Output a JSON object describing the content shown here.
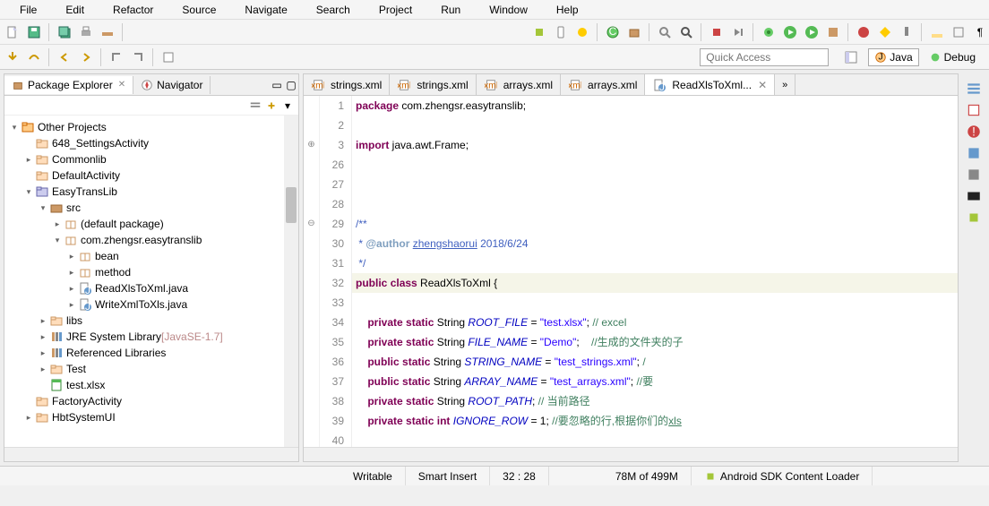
{
  "menus": [
    "File",
    "Edit",
    "Refactor",
    "Source",
    "Navigate",
    "Search",
    "Project",
    "Run",
    "Window",
    "Help"
  ],
  "quick_access_placeholder": "Quick Access",
  "perspectives": {
    "java": "Java",
    "debug": "Debug"
  },
  "left": {
    "tabs": {
      "pkg": "Package Explorer",
      "nav": "Navigator"
    },
    "tree": [
      {
        "d": 0,
        "tw": "▾",
        "ic": "proj",
        "t": "Other Projects"
      },
      {
        "d": 1,
        "tw": "",
        "ic": "fldr",
        "t": "648_SettingsActivity"
      },
      {
        "d": 1,
        "tw": "▸",
        "ic": "fldr",
        "t": "Commonlib"
      },
      {
        "d": 1,
        "tw": "",
        "ic": "fldr",
        "t": "DefaultActivity"
      },
      {
        "d": 1,
        "tw": "▾",
        "ic": "prj",
        "t": "EasyTransLib"
      },
      {
        "d": 2,
        "tw": "▾",
        "ic": "src",
        "t": "src"
      },
      {
        "d": 3,
        "tw": "▸",
        "ic": "pkg",
        "t": "(default package)"
      },
      {
        "d": 3,
        "tw": "▾",
        "ic": "pkg",
        "t": "com.zhengsr.easytranslib"
      },
      {
        "d": 4,
        "tw": "▸",
        "ic": "pkg",
        "t": "bean"
      },
      {
        "d": 4,
        "tw": "▸",
        "ic": "pkg",
        "t": "method"
      },
      {
        "d": 4,
        "tw": "▸",
        "ic": "java",
        "t": "ReadXlsToXml.java"
      },
      {
        "d": 4,
        "tw": "▸",
        "ic": "java",
        "t": "WriteXmlToXls.java"
      },
      {
        "d": 2,
        "tw": "▸",
        "ic": "fldr",
        "t": "libs"
      },
      {
        "d": 2,
        "tw": "▸",
        "ic": "lib",
        "t": "JRE System Library",
        "suf": " [JavaSE-1.7]"
      },
      {
        "d": 2,
        "tw": "▸",
        "ic": "lib",
        "t": "Referenced Libraries"
      },
      {
        "d": 2,
        "tw": "▸",
        "ic": "fldr",
        "t": "Test"
      },
      {
        "d": 2,
        "tw": "",
        "ic": "xls",
        "t": "test.xlsx"
      },
      {
        "d": 1,
        "tw": "",
        "ic": "fldr",
        "t": "FactoryActivity"
      },
      {
        "d": 1,
        "tw": "▸",
        "ic": "fldr",
        "t": "HbtSystemUI"
      }
    ]
  },
  "editor": {
    "tabs": [
      {
        "label": "strings.xml",
        "ic": "xml"
      },
      {
        "label": "strings.xml",
        "ic": "xml"
      },
      {
        "label": "arrays.xml",
        "ic": "xml"
      },
      {
        "label": "arrays.xml",
        "ic": "xml"
      },
      {
        "label": "ReadXlsToXml...",
        "ic": "java",
        "active": true
      }
    ],
    "lines": [
      {
        "n": 1,
        "h": "<span class='kw'>package</span> com.zhengsr.easytranslib;"
      },
      {
        "n": 2,
        "h": ""
      },
      {
        "n": 3,
        "h": "<span class='kw'>import</span> java.awt.Frame;",
        "mark": "⊕"
      },
      {
        "n": 26,
        "h": ""
      },
      {
        "n": 27,
        "h": ""
      },
      {
        "n": 28,
        "h": ""
      },
      {
        "n": 29,
        "h": "<span class='doc'>/**</span>",
        "mark": "⊖"
      },
      {
        "n": 30,
        "h": "<span class='doc'> * <span class='doctag'>@author</span> <u>zhengshaorui</u> 2018/6/24</span>"
      },
      {
        "n": 31,
        "h": "<span class='doc'> */</span>"
      },
      {
        "n": 32,
        "h": "<span class='kw'>public</span> <span class='kw'>class</span> ReadXlsToXml {",
        "hl": true
      },
      {
        "n": 33,
        "h": ""
      },
      {
        "n": 34,
        "h": "    <span class='kw'>private</span> <span class='kw'>static</span> String <span class='field-it'>ROOT_FILE</span> = <span class='str'>\"test.xlsx\"</span>; <span class='com'>// excel</span>"
      },
      {
        "n": 35,
        "h": "    <span class='kw'>private</span> <span class='kw'>static</span> String <span class='field-it'>FILE_NAME</span> = <span class='str'>\"Demo\"</span>;    <span class='com'>//生成的文件夹的子</span>"
      },
      {
        "n": 36,
        "h": "    <span class='kw'>public</span> <span class='kw'>static</span> String <span class='field-it'>STRING_NAME</span> = <span class='str'>\"test_strings.xml\"</span>; <span class='com'>/</span>"
      },
      {
        "n": 37,
        "h": "    <span class='kw'>public</span> <span class='kw'>static</span> String <span class='field-it'>ARRAY_NAME</span> = <span class='str'>\"test_arrays.xml\"</span>; <span class='com'>//要</span>"
      },
      {
        "n": 38,
        "h": "    <span class='kw'>private</span> <span class='kw'>static</span> String <span class='field-it'>ROOT_PATH</span>; <span class='com'>// 当前路径</span>"
      },
      {
        "n": 39,
        "h": "    <span class='kw'>private</span> <span class='kw'>static</span> <span class='kw'>int</span> <span class='field-it'>IGNORE_ROW</span> = 1; <span class='com'>//要忽略的行,根据你们的<u>xls</u></span>"
      },
      {
        "n": 40,
        "h": ""
      }
    ]
  },
  "status": {
    "writable": "Writable",
    "insert": "Smart Insert",
    "pos": "32 : 28",
    "mem": "78M of 499M",
    "task": "Android SDK Content Loader"
  }
}
